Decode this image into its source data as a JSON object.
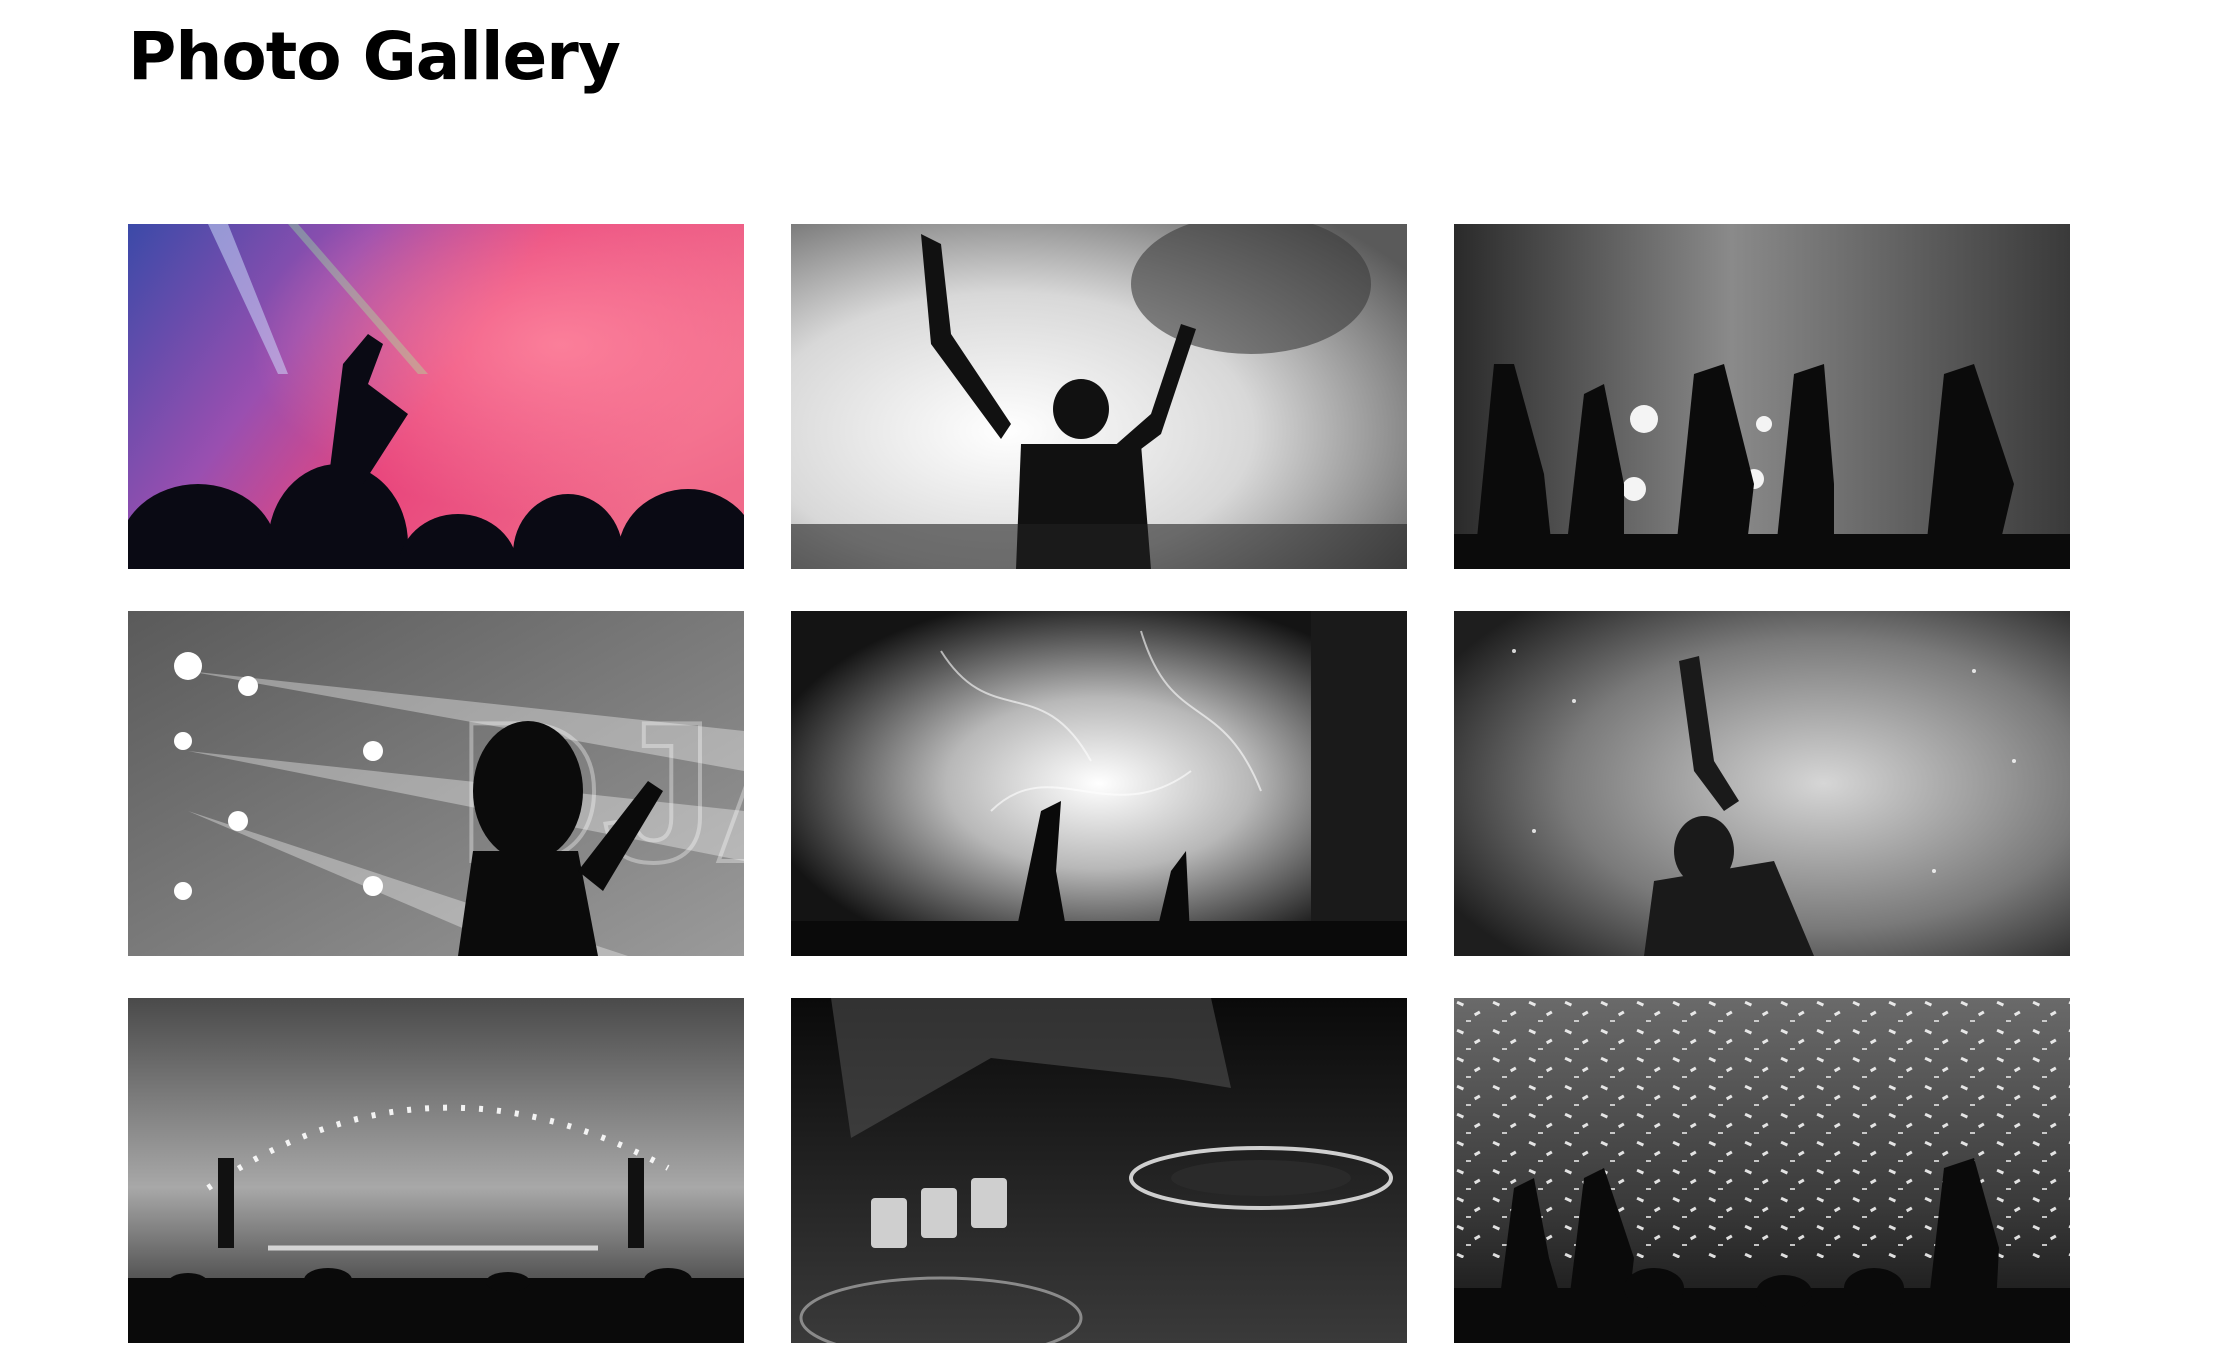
{
  "header": {
    "title": "Photo Gallery"
  },
  "gallery": {
    "photos": [
      {
        "subject": "concert crowd under pink and blue stage lights",
        "color": "color"
      },
      {
        "subject": "woman with raised arms in smoke",
        "color": "grayscale"
      },
      {
        "subject": "silhouetted raised hands against stage lights",
        "color": "grayscale"
      },
      {
        "subject": "woman waving in front of stage spotlights",
        "color": "grayscale"
      },
      {
        "subject": "sparkling fireworks over crowd",
        "color": "grayscale"
      },
      {
        "subject": "man with raised hand in haze",
        "color": "grayscale"
      },
      {
        "subject": "arena stage with confetti and lights",
        "color": "grayscale"
      },
      {
        "subject": "dj hand over mixer turntable",
        "color": "grayscale"
      },
      {
        "subject": "crowd under falling confetti",
        "color": "grayscale"
      }
    ]
  },
  "colors": {
    "background": "#ffffff",
    "title": "#000000"
  }
}
